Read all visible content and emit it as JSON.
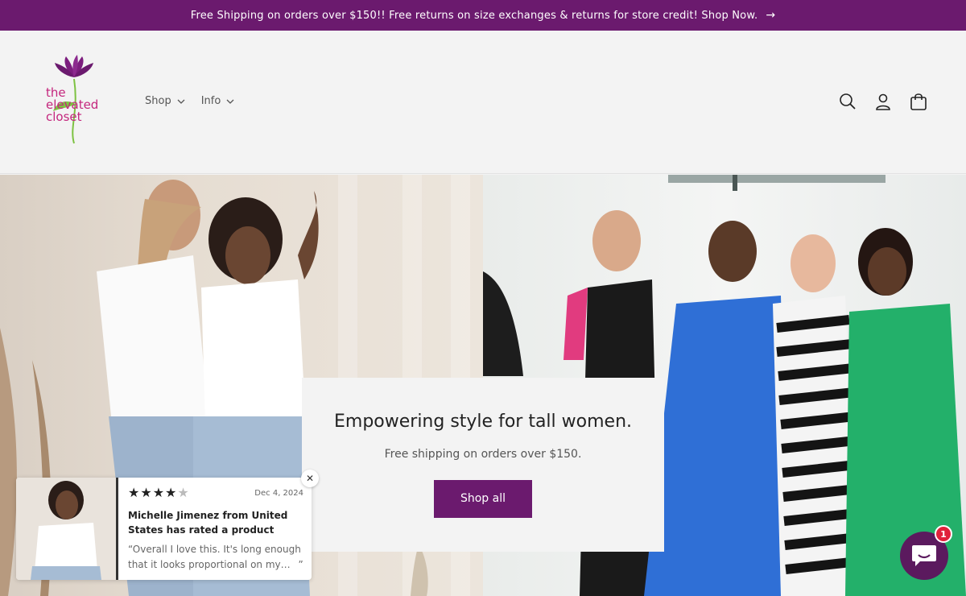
{
  "announcement": {
    "text": "Free Shipping on orders over $150!! Free returns on size exchanges & returns for store credit! Shop Now.",
    "arrow": "→"
  },
  "logo": {
    "line1": "the",
    "line2": "elevated",
    "line3": "closet"
  },
  "nav": {
    "items": [
      {
        "label": "Shop",
        "icon": "chevron-down-icon"
      },
      {
        "label": "Info",
        "icon": "chevron-down-icon"
      }
    ]
  },
  "header_icons": [
    "search-icon",
    "account-icon",
    "cart-icon"
  ],
  "hero": {
    "heading": "Empowering style for tall women.",
    "subtext": "Free shipping on orders over $150.",
    "button": "Shop all"
  },
  "review": {
    "rating": 4,
    "max_rating": 5,
    "date": "Dec 4, 2024",
    "title": "Michelle Jimenez from United States has rated a product",
    "quote": "“Overall I love this. It's long enough that it looks proportional on my…",
    "quote_end": "”"
  },
  "chat": {
    "badge": "1"
  },
  "colors": {
    "brand": "#6b1a6e",
    "logo_pink": "#c4267d",
    "badge": "#e0213a"
  }
}
